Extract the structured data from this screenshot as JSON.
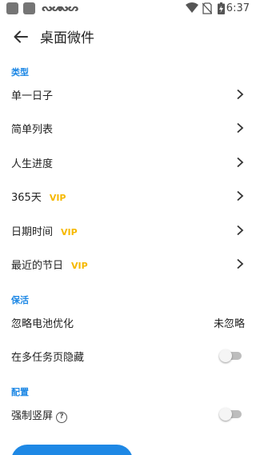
{
  "status_bar": {
    "time": "6:37",
    "icons": [
      "app-notification-icon",
      "app-notification-icon",
      "link-icon",
      "link-icon",
      "wifi-icon",
      "no-sim-icon",
      "battery-charging-icon"
    ]
  },
  "header": {
    "title": "桌面微件",
    "back_icon": "arrow-left-icon"
  },
  "sections": {
    "type": {
      "title": "类型",
      "items": [
        {
          "label": "单一日子",
          "vip": ""
        },
        {
          "label": "简单列表",
          "vip": ""
        },
        {
          "label": "人生进度",
          "vip": ""
        },
        {
          "label": "365天",
          "vip": "VIP"
        },
        {
          "label": "日期时间",
          "vip": "VIP"
        },
        {
          "label": "最近的节日",
          "vip": "VIP"
        }
      ]
    },
    "keepalive": {
      "title": "保活",
      "battery_label": "忽略电池优化",
      "battery_value": "未忽略",
      "hide_label": "在多任务页隐藏",
      "hide_enabled": false
    },
    "config": {
      "title": "配置",
      "portrait_label": "强制竖屏",
      "portrait_help_icon": "help-circle-icon",
      "portrait_enabled": false
    }
  },
  "colors": {
    "accent": "#1e88e5",
    "vip": "#f6b800",
    "text": "#222222"
  }
}
